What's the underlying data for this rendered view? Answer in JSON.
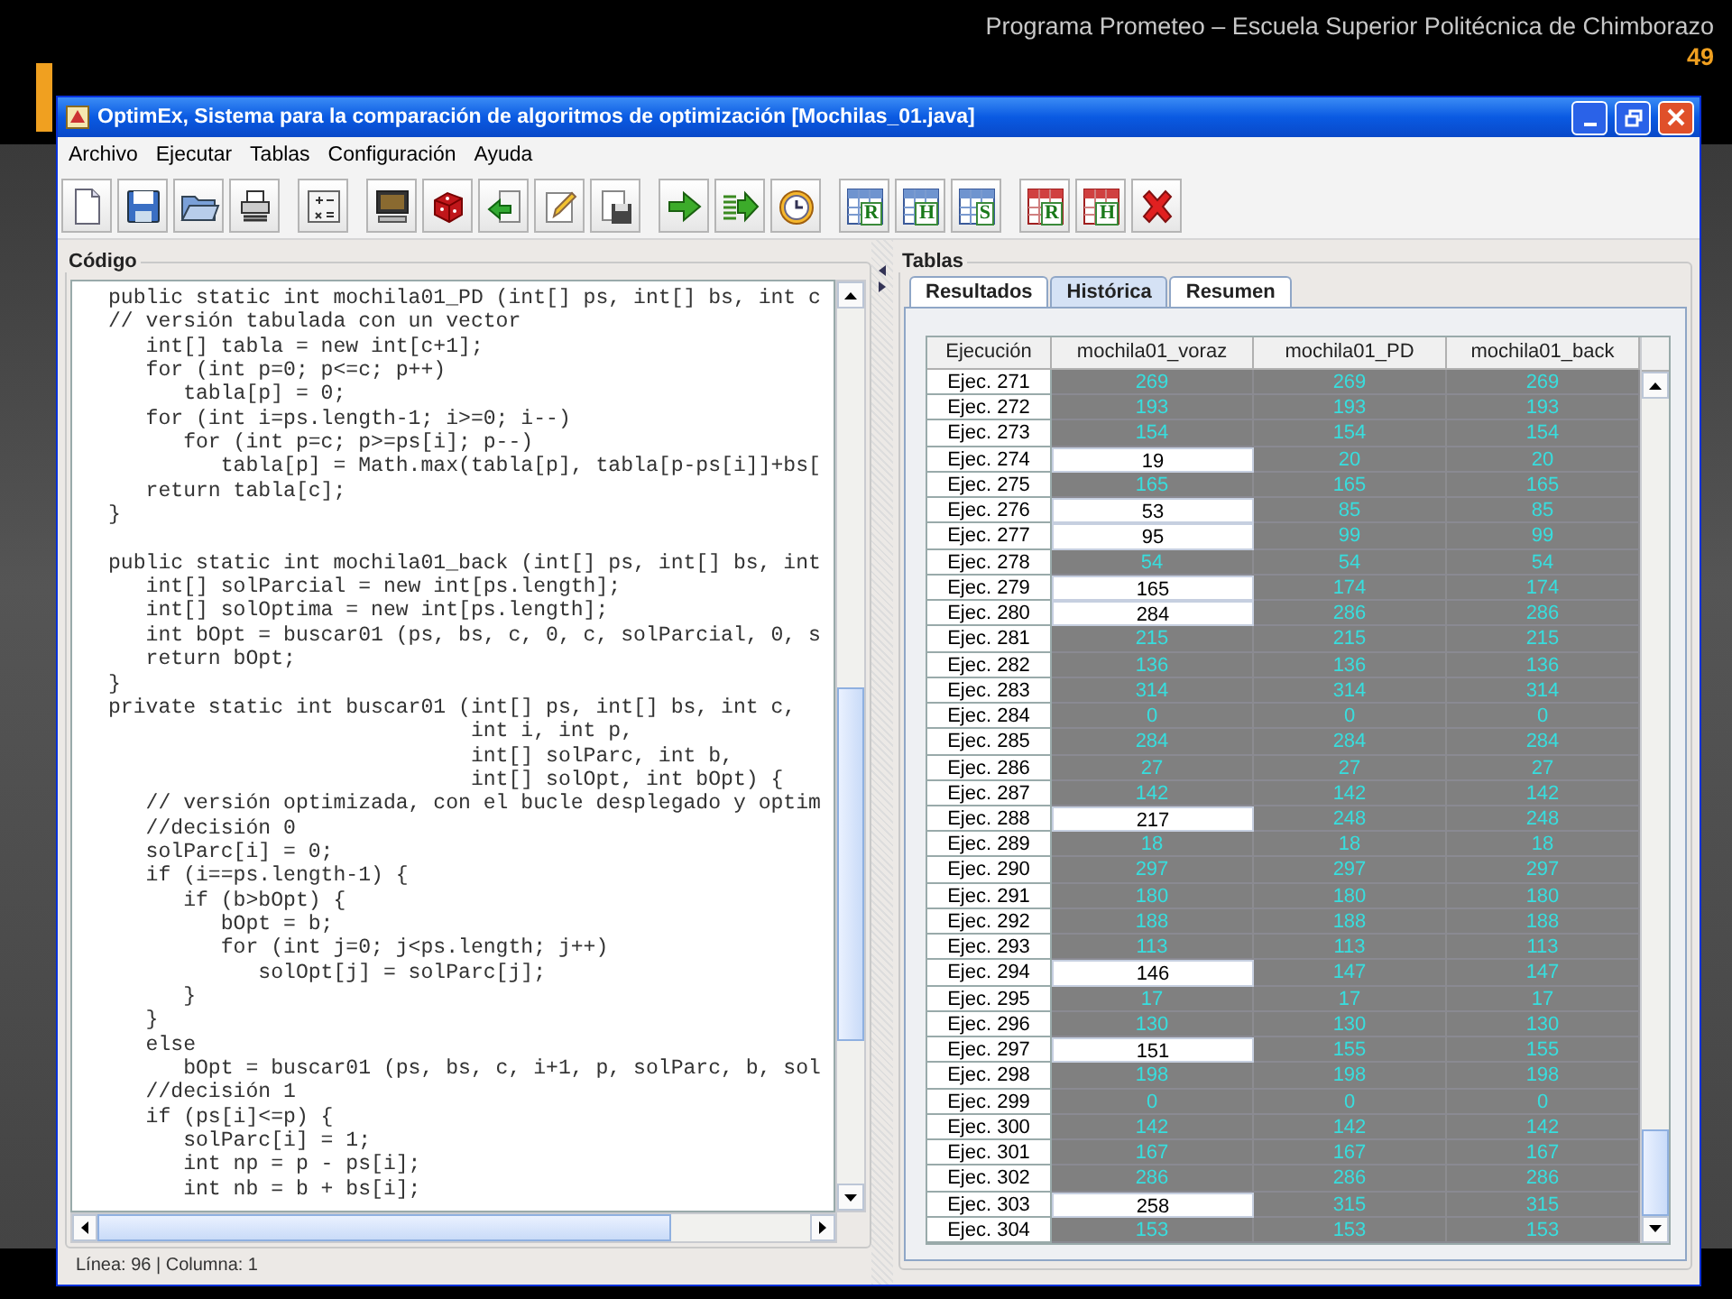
{
  "slide": {
    "header": "Programa Prometeo – Escuela Superior Politécnica de Chimborazo",
    "page_number": "49"
  },
  "window": {
    "title": "OptimEx, Sistema para la comparación de algoritmos de optimización [Mochilas_01.java]"
  },
  "menu": [
    "Archivo",
    "Ejecutar",
    "Tablas",
    "Configuración",
    "Ayuda"
  ],
  "toolbar": [
    [
      {
        "kind": "new"
      },
      {
        "kind": "save"
      },
      {
        "kind": "open"
      },
      {
        "kind": "print"
      }
    ],
    [
      {
        "kind": "calc"
      }
    ],
    [
      {
        "kind": "monitor"
      },
      {
        "kind": "dice"
      },
      {
        "kind": "import"
      },
      {
        "kind": "edit"
      },
      {
        "kind": "disk"
      }
    ],
    [
      {
        "kind": "run"
      },
      {
        "kind": "runall"
      },
      {
        "kind": "clock"
      }
    ],
    [
      {
        "kind": "table",
        "letter": "R"
      },
      {
        "kind": "table",
        "letter": "H"
      },
      {
        "kind": "table",
        "letter": "S"
      }
    ],
    [
      {
        "kind": "report",
        "letter": "R"
      },
      {
        "kind": "report",
        "letter": "H"
      },
      {
        "kind": "delete"
      }
    ]
  ],
  "code_panel": {
    "title": "Código",
    "lines": [
      "public static int mochila01_PD (int[] ps, int[] bs, int c",
      "// versión tabulada con un vector",
      "   int[] tabla = new int[c+1];",
      "   for (int p=0; p<=c; p++)",
      "      tabla[p] = 0;",
      "   for (int i=ps.length-1; i>=0; i--)",
      "      for (int p=c; p>=ps[i]; p--)",
      "         tabla[p] = Math.max(tabla[p], tabla[p-ps[i]]+bs[",
      "   return tabla[c];",
      "}",
      {
        "kind": "blank"
      },
      "public static int mochila01_back (int[] ps, int[] bs, int",
      "   int[] solParcial = new int[ps.length];",
      "   int[] solOptima = new int[ps.length];",
      "   int bOpt = buscar01 (ps, bs, c, 0, c, solParcial, 0, s",
      "   return bOpt;",
      "}",
      "private static int buscar01 (int[] ps, int[] bs, int c,",
      "                             int i, int p,",
      "                             int[] solParc, int b,",
      "                             int[] solOpt, int bOpt) {",
      "   // versión optimizada, con el bucle desplegado y optim",
      "   //decisión 0",
      "   solParc[i] = 0;",
      "   if (i==ps.length-1) {",
      "      if (b>bOpt) {",
      "         bOpt = b;",
      "         for (int j=0; j<ps.length; j++)",
      "            solOpt[j] = solParc[j];",
      "      }",
      "   }",
      "   else",
      "      bOpt = buscar01 (ps, bs, c, i+1, p, solParc, b, sol",
      "   //decisión 1",
      "   if (ps[i]<=p) {",
      "      solParc[i] = 1;",
      "      int np = p - ps[i];",
      "      int nb = b + bs[i];"
    ],
    "status": "Línea: 96 | Columna: 1"
  },
  "tables_panel": {
    "title": "Tablas",
    "tabs": [
      {
        "label": "Resultados",
        "selected": false
      },
      {
        "label": "Histórica",
        "selected": true
      },
      {
        "label": "Resumen",
        "selected": false
      }
    ],
    "table": {
      "columns": [
        "Ejecución",
        "mochila01_voraz",
        "mochila01_PD",
        "mochila01_back"
      ],
      "rows": [
        {
          "cells": [
            "Ejec. 271",
            "269",
            "269",
            "269"
          ],
          "highlighted": false
        },
        {
          "cells": [
            "Ejec. 272",
            "193",
            "193",
            "193"
          ],
          "highlighted": false
        },
        {
          "cells": [
            "Ejec. 273",
            "154",
            "154",
            "154"
          ],
          "highlighted": false
        },
        {
          "cells": [
            "Ejec. 274",
            "19",
            "20",
            "20"
          ],
          "highlighted": true
        },
        {
          "cells": [
            "Ejec. 275",
            "165",
            "165",
            "165"
          ],
          "highlighted": false
        },
        {
          "cells": [
            "Ejec. 276",
            "53",
            "85",
            "85"
          ],
          "highlighted": true
        },
        {
          "cells": [
            "Ejec. 277",
            "95",
            "99",
            "99"
          ],
          "highlighted": true
        },
        {
          "cells": [
            "Ejec. 278",
            "54",
            "54",
            "54"
          ],
          "highlighted": false
        },
        {
          "cells": [
            "Ejec. 279",
            "165",
            "174",
            "174"
          ],
          "highlighted": true
        },
        {
          "cells": [
            "Ejec. 280",
            "284",
            "286",
            "286"
          ],
          "highlighted": true
        },
        {
          "cells": [
            "Ejec. 281",
            "215",
            "215",
            "215"
          ],
          "highlighted": false
        },
        {
          "cells": [
            "Ejec. 282",
            "136",
            "136",
            "136"
          ],
          "highlighted": false
        },
        {
          "cells": [
            "Ejec. 283",
            "314",
            "314",
            "314"
          ],
          "highlighted": false
        },
        {
          "cells": [
            "Ejec. 284",
            "0",
            "0",
            "0"
          ],
          "highlighted": false
        },
        {
          "cells": [
            "Ejec. 285",
            "284",
            "284",
            "284"
          ],
          "highlighted": false
        },
        {
          "cells": [
            "Ejec. 286",
            "27",
            "27",
            "27"
          ],
          "highlighted": false
        },
        {
          "cells": [
            "Ejec. 287",
            "142",
            "142",
            "142"
          ],
          "highlighted": false
        },
        {
          "cells": [
            "Ejec. 288",
            "217",
            "248",
            "248"
          ],
          "highlighted": true
        },
        {
          "cells": [
            "Ejec. 289",
            "18",
            "18",
            "18"
          ],
          "highlighted": false
        },
        {
          "cells": [
            "Ejec. 290",
            "297",
            "297",
            "297"
          ],
          "highlighted": false
        },
        {
          "cells": [
            "Ejec. 291",
            "180",
            "180",
            "180"
          ],
          "highlighted": false
        },
        {
          "cells": [
            "Ejec. 292",
            "188",
            "188",
            "188"
          ],
          "highlighted": false
        },
        {
          "cells": [
            "Ejec. 293",
            "113",
            "113",
            "113"
          ],
          "highlighted": false
        },
        {
          "cells": [
            "Ejec. 294",
            "146",
            "147",
            "147"
          ],
          "highlighted": true
        },
        {
          "cells": [
            "Ejec. 295",
            "17",
            "17",
            "17"
          ],
          "highlighted": false
        },
        {
          "cells": [
            "Ejec. 296",
            "130",
            "130",
            "130"
          ],
          "highlighted": false
        },
        {
          "cells": [
            "Ejec. 297",
            "151",
            "155",
            "155"
          ],
          "highlighted": true
        },
        {
          "cells": [
            "Ejec. 298",
            "198",
            "198",
            "198"
          ],
          "highlighted": false
        },
        {
          "cells": [
            "Ejec. 299",
            "0",
            "0",
            "0"
          ],
          "highlighted": false
        },
        {
          "cells": [
            "Ejec. 300",
            "142",
            "142",
            "142"
          ],
          "highlighted": false
        },
        {
          "cells": [
            "Ejec. 301",
            "167",
            "167",
            "167"
          ],
          "highlighted": false
        },
        {
          "cells": [
            "Ejec. 302",
            "286",
            "286",
            "286"
          ],
          "highlighted": false
        },
        {
          "cells": [
            "Ejec. 303",
            "258",
            "315",
            "315"
          ],
          "highlighted": true
        },
        {
          "cells": [
            "Ejec. 304",
            "153",
            "153",
            "153"
          ],
          "highlighted": false
        }
      ]
    }
  }
}
